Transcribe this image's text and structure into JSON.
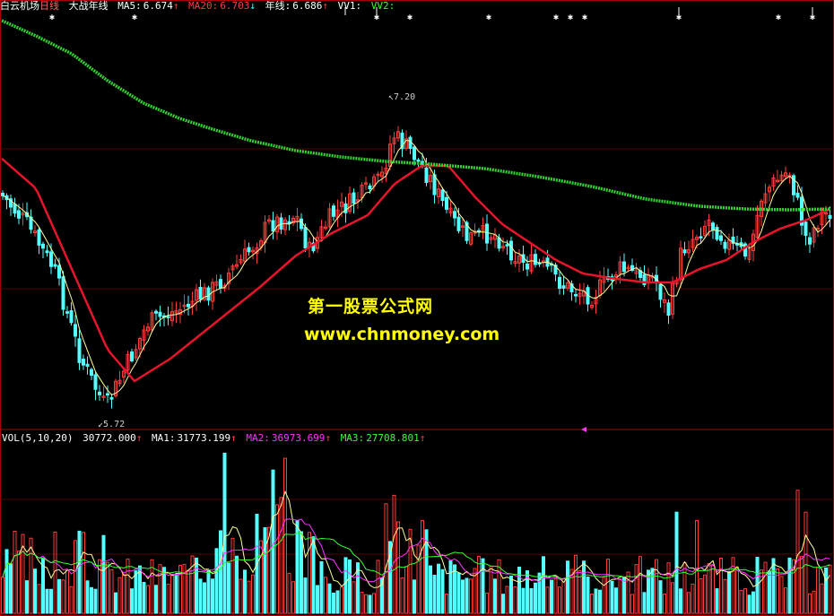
{
  "header": {
    "stock_name": "白云机场",
    "period": "日线",
    "formula": "大战年线",
    "ma5_label": "MA5:",
    "ma5_value": "6.674",
    "ma20_label": "MA20:",
    "ma20_value": "6.703",
    "year_label": "年线:",
    "year_value": "6.686",
    "vv1_label": "VV1:",
    "vv2_label": "VV2:",
    "up_arrow": "↑",
    "down_arrow": "↓",
    "ma5_arrow": "↑",
    "ma20_arrow": "↓",
    "year_arrow": "↑",
    "vv1_arrow": ""
  },
  "price_marks": {
    "high": "7.20",
    "low": "5.72"
  },
  "volume_header": {
    "label": "VOL(5,10,20)",
    "vol_value": "30772.000",
    "ma1_label": "MA1:",
    "ma1_value": "31773.199",
    "ma2_label": "MA2:",
    "ma2_value": "36973.699",
    "ma3_label": "MA3:",
    "ma3_value": "27708.801",
    "vol_arrow": "↑",
    "ma1_arrow": "↑",
    "ma2_arrow": "↑",
    "ma3_arrow": "↑"
  },
  "watermark": {
    "line1": "第一股票公式网",
    "line2": "www.chnmoney.com"
  },
  "colors": {
    "up_candle": "#ff3c3c",
    "down_candle": "#54ffff",
    "ma20": "#e8142c",
    "year_line": "#32d232",
    "ma5": "#ffff99",
    "vol_ma2": "#ff33ff",
    "vol_ma3": "#33ff33",
    "vol_ma1": "#ffff99"
  },
  "chart_data": {
    "type": "candlestick",
    "price_range": [
      5.72,
      7.2
    ],
    "series": [
      {
        "name": "MA5",
        "last": 6.674
      },
      {
        "name": "MA20",
        "last": 6.703
      },
      {
        "name": "年线",
        "last": 6.686
      }
    ],
    "volume_series": [
      {
        "name": "VOL",
        "last": 30772.0
      },
      {
        "name": "MA1",
        "last": 31773.199
      },
      {
        "name": "MA2",
        "last": 36973.699
      },
      {
        "name": "MA3",
        "last": 27708.801
      }
    ]
  }
}
